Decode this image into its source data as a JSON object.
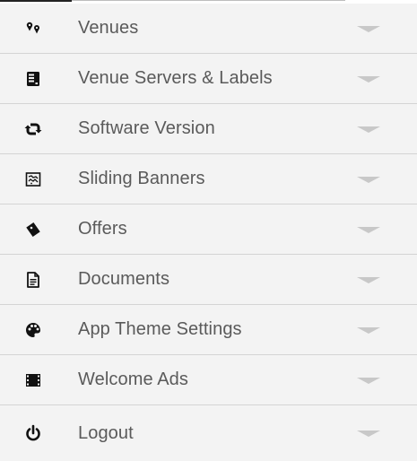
{
  "menu": {
    "items": [
      {
        "label": "Venues",
        "icon": "map-pins-icon"
      },
      {
        "label": "Venue Servers & Labels",
        "icon": "server-icon"
      },
      {
        "label": "Software Version",
        "icon": "sync-icon"
      },
      {
        "label": "Sliding Banners",
        "icon": "map-banner-icon"
      },
      {
        "label": "Offers",
        "icon": "ticket-icon"
      },
      {
        "label": "Documents",
        "icon": "document-icon"
      },
      {
        "label": "App Theme Settings",
        "icon": "palette-icon"
      },
      {
        "label": "Welcome Ads",
        "icon": "film-icon"
      },
      {
        "label": "Logout",
        "icon": "power-icon"
      }
    ]
  },
  "colors": {
    "background": "#f3f3f3",
    "divider": "#d4d4d4",
    "label": "#5a5a5a",
    "icon": "#111111",
    "chevron": "#c8c8c8"
  }
}
